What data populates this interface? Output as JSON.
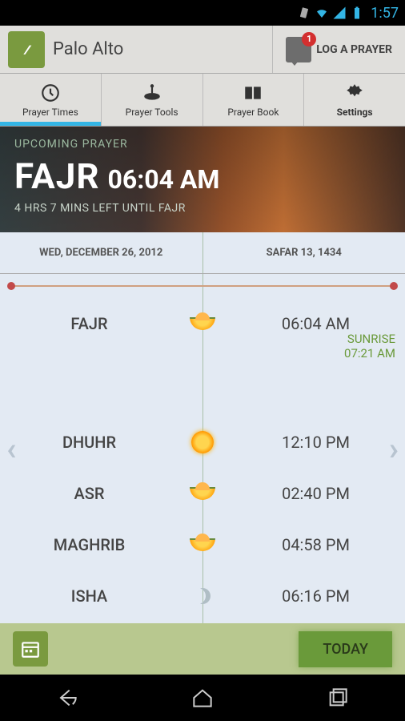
{
  "status": {
    "time": "1:57"
  },
  "header": {
    "location": "Palo Alto",
    "log_label": "LOG A PRAYER",
    "badge": "1"
  },
  "tabs": [
    {
      "label": "Prayer Times",
      "icon": "clock-icon",
      "active": true
    },
    {
      "label": "Prayer Tools",
      "icon": "tools-icon",
      "active": false
    },
    {
      "label": "Prayer Book",
      "icon": "book-icon",
      "active": false
    },
    {
      "label": "Settings",
      "icon": "gear-icon",
      "active": false
    }
  ],
  "hero": {
    "upcoming_label": "UPCOMING PRAYER",
    "name": "FAJR",
    "time": "06:04 AM",
    "countdown": "4 HRS 7 MINS  LEFT UNTIL  FAJR"
  },
  "dates": {
    "gregorian": "WED, DECEMBER 26, 2012",
    "hijri": "SAFAR 13, 1434"
  },
  "sunrise": {
    "label": "SUNRISE",
    "time": "07:21 AM"
  },
  "prayers": [
    {
      "name": "FAJR",
      "time": "06:04 AM",
      "icon": "sunrise"
    },
    {
      "name": "DHUHR",
      "time": "12:10 PM",
      "icon": "sun"
    },
    {
      "name": "ASR",
      "time": "02:40 PM",
      "icon": "sunset"
    },
    {
      "name": "MAGHRIB",
      "time": "04:58 PM",
      "icon": "sunset"
    },
    {
      "name": "ISHA",
      "time": "06:16 PM",
      "icon": "moon"
    }
  ],
  "footer": {
    "today_label": "TODAY"
  }
}
